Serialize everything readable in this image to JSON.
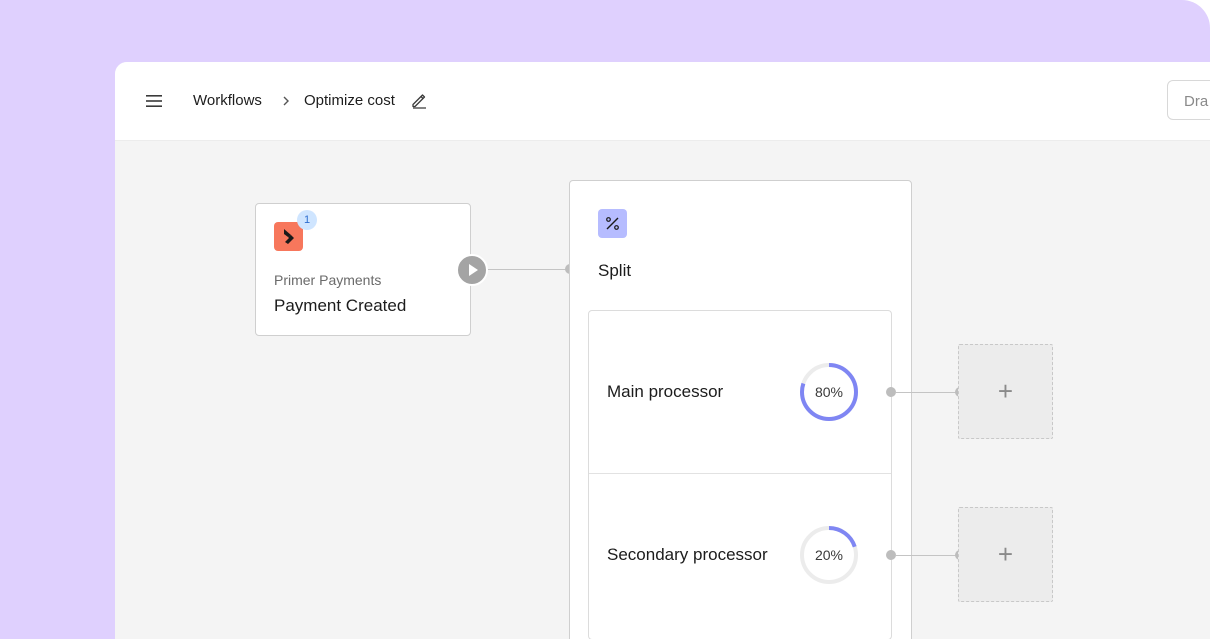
{
  "header": {
    "menu_icon": "hamburger-menu-icon",
    "breadcrumb_root": "Workflows",
    "breadcrumb_separator_icon": "chevron-right-icon",
    "breadcrumb_current": "Optimize cost",
    "edit_icon": "pencil-icon",
    "status_button_label": "Dra"
  },
  "trigger": {
    "icon": "primer-logo-icon",
    "icon_color": "#f7775c",
    "badge_count": "1",
    "provider": "Primer Payments",
    "event": "Payment Created",
    "play_icon": "play-icon"
  },
  "split": {
    "icon": "percent-icon",
    "icon_color": "#b6bcff",
    "title": "Split",
    "branches": [
      {
        "label": "Main processor",
        "percent": 80,
        "percent_label": "80%"
      },
      {
        "label": "Secondary processor",
        "percent": 20,
        "percent_label": "20%"
      }
    ],
    "ring_color": "#7f86f3",
    "add_icon": "plus-icon"
  }
}
